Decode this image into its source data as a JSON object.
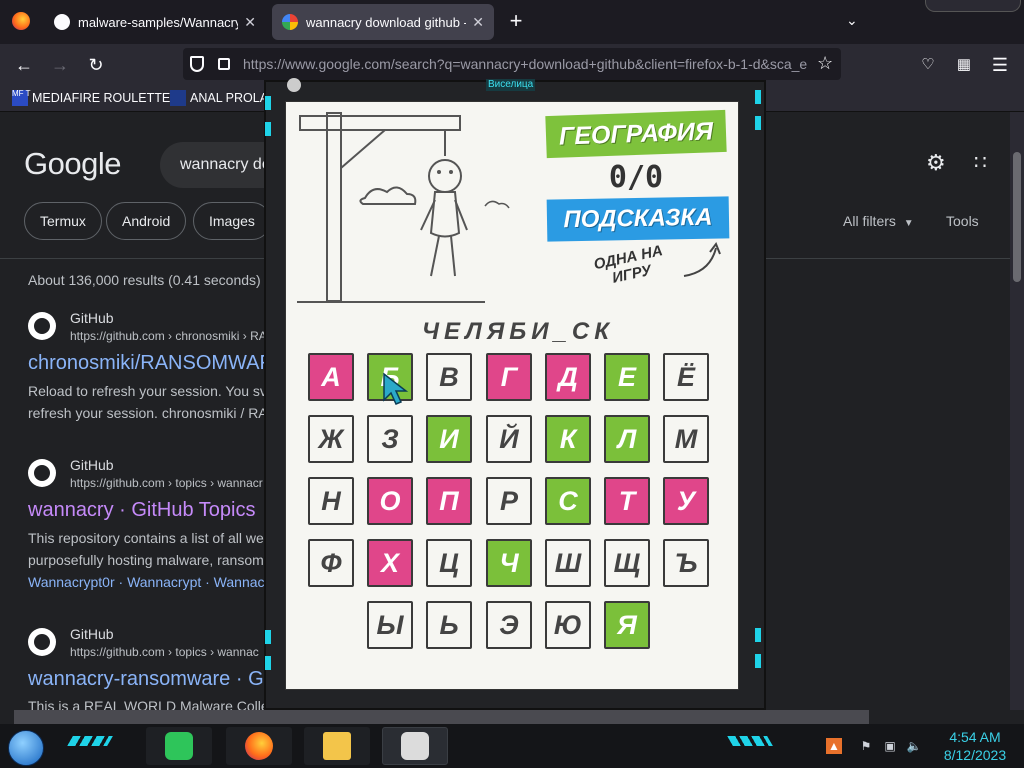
{
  "browser": {
    "tabs": [
      {
        "label": "malware-samples/Wannacry at",
        "active": false
      },
      {
        "label": "wannacry download github - G",
        "active": true
      }
    ],
    "new_tab": "+",
    "url": "https://www.google.com/search?q=wannacry+download+github&client=firefox-b-1-d&sca_e",
    "bookmarks": [
      {
        "label": "MEDIAFIRE ROULETTER",
        "icon_text": "MF T"
      },
      {
        "label": "ANAL PROLAP"
      }
    ]
  },
  "google": {
    "logo": "Google",
    "query": "wannacry do",
    "chips": [
      "Termux",
      "Android",
      "Images"
    ],
    "all_filters": "All filters",
    "tools": "Tools",
    "stats": "About 136,000 results (0.41 seconds)",
    "results": [
      {
        "site": "GitHub",
        "url": "https://github.com › chronosmiki › RA",
        "title": "chronosmiki/RANSOMWAF",
        "snippet": [
          "Reload to refresh your session. You sv",
          "refresh your session. chronosmiki / RA"
        ],
        "links": ""
      },
      {
        "site": "GitHub",
        "url": "https://github.com › topics › wannacr",
        "title": "wannacry · GitHub Topics",
        "snippet": [
          "This repository contains a list of all we",
          "purposefully hosting malware, ransome"
        ],
        "links": "Wannacrypt0r · Wannacrypt · Wannac"
      },
      {
        "site": "GitHub",
        "url": "https://github.com › topics › wannac",
        "title": "wannacry-ransomware · G",
        "snippet": [
          "This is a REAL WORLD Malware Collection I have Compiled & analysed by researchers to"
        ],
        "links": ""
      }
    ]
  },
  "game": {
    "window_title": "Виселица",
    "category": "ГЕОГРАФИЯ",
    "score": "0/0",
    "hint_button": "ПОДСКАЗКА",
    "hint_note": "ОДНА НА ИГРУ",
    "word": "ЧЕЛЯБИ_СК",
    "keys": [
      {
        "l": "А",
        "s": "wrong"
      },
      {
        "l": "Б",
        "s": "right"
      },
      {
        "l": "В",
        "s": ""
      },
      {
        "l": "Г",
        "s": "wrong"
      },
      {
        "l": "Д",
        "s": "wrong"
      },
      {
        "l": "Е",
        "s": "right"
      },
      {
        "l": "Ё",
        "s": ""
      },
      {
        "l": "Ж",
        "s": ""
      },
      {
        "l": "З",
        "s": ""
      },
      {
        "l": "И",
        "s": "right"
      },
      {
        "l": "Й",
        "s": ""
      },
      {
        "l": "К",
        "s": "right"
      },
      {
        "l": "Л",
        "s": "right"
      },
      {
        "l": "М",
        "s": ""
      },
      {
        "l": "Н",
        "s": ""
      },
      {
        "l": "О",
        "s": "wrong"
      },
      {
        "l": "П",
        "s": "wrong"
      },
      {
        "l": "Р",
        "s": ""
      },
      {
        "l": "С",
        "s": "right"
      },
      {
        "l": "Т",
        "s": "wrong"
      },
      {
        "l": "У",
        "s": "wrong"
      },
      {
        "l": "Ф",
        "s": ""
      },
      {
        "l": "Х",
        "s": "wrong"
      },
      {
        "l": "Ц",
        "s": ""
      },
      {
        "l": "Ч",
        "s": "right"
      },
      {
        "l": "Ш",
        "s": ""
      },
      {
        "l": "Щ",
        "s": ""
      },
      {
        "l": "Ъ",
        "s": ""
      },
      {
        "l": "Ы",
        "s": ""
      },
      {
        "l": "Ь",
        "s": ""
      },
      {
        "l": "Э",
        "s": ""
      },
      {
        "l": "Ю",
        "s": ""
      },
      {
        "l": "Я",
        "s": "right"
      }
    ]
  },
  "taskbar": {
    "time": "4:54 AM",
    "date": "8/12/2023"
  },
  "colors": {
    "wrong_key": "#e0468a",
    "right_key": "#7bc03a",
    "category_banner": "#7ec23c",
    "hint_button": "#2b9be3",
    "neon_accent": "#1fd3e8"
  }
}
